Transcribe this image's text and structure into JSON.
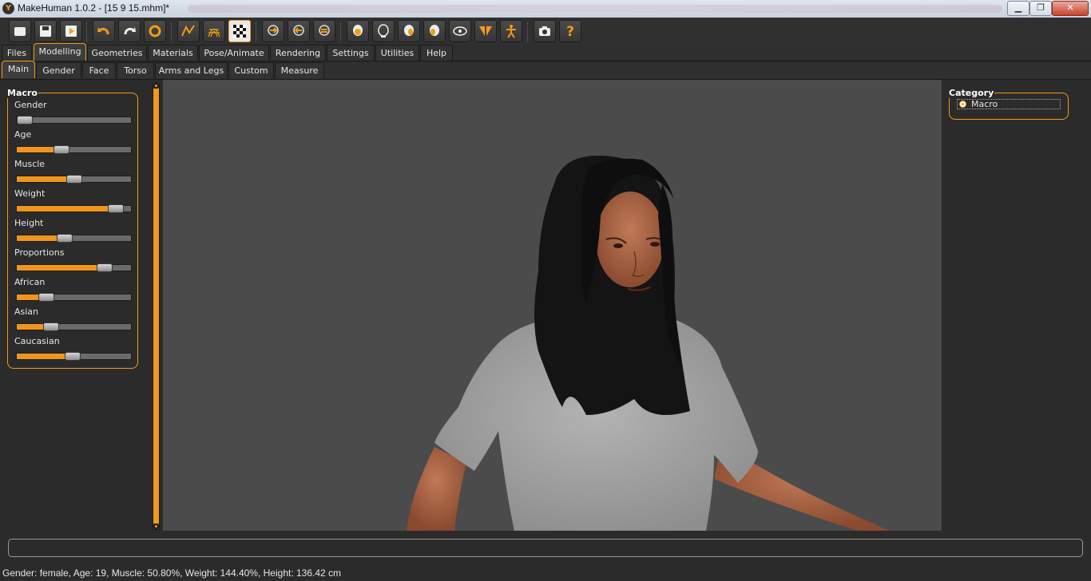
{
  "window": {
    "title": "MakeHuman 1.0.2 - [15 9 15.mhm]*",
    "buttons": {
      "minimize": "▁",
      "maximize": "❐",
      "close": "✕"
    }
  },
  "toolbar": {
    "icons": [
      "new-icon",
      "save-icon",
      "export-icon",
      "undo-icon",
      "redo-icon",
      "reset-icon",
      "smooth-icon",
      "wireframe-icon",
      "background-icon",
      "front-view-icon",
      "back-view-icon",
      "side-view-icon",
      "face-front-icon",
      "face-back-icon",
      "face-left-icon",
      "face-right-icon",
      "top-view-icon",
      "bottom-view-icon",
      "skeleton-icon",
      "screenshot-icon",
      "help-icon"
    ],
    "active": "background-icon",
    "accent": "#f39c12"
  },
  "main_tabs": [
    "Files",
    "Modelling",
    "Geometries",
    "Materials",
    "Pose/Animate",
    "Rendering",
    "Settings",
    "Utilities",
    "Help"
  ],
  "main_tab_active": "Modelling",
  "sub_tabs": [
    "Main",
    "Gender",
    "Face",
    "Torso",
    "Arms and Legs",
    "Custom",
    "Measure"
  ],
  "sub_tab_active": "Main",
  "macro": {
    "title": "Macro",
    "sliders": [
      {
        "label": "Gender",
        "value": 0.07
      },
      {
        "label": "Age",
        "value": 0.39
      },
      {
        "label": "Muscle",
        "value": 0.5
      },
      {
        "label": "Weight",
        "value": 0.87
      },
      {
        "label": "Height",
        "value": 0.42
      },
      {
        "label": "Proportions",
        "value": 0.77
      },
      {
        "label": "African",
        "value": 0.26
      },
      {
        "label": "Asian",
        "value": 0.3
      },
      {
        "label": "Caucasian",
        "value": 0.49
      }
    ]
  },
  "category": {
    "title": "Category",
    "items": [
      {
        "label": "Macro",
        "selected": true
      }
    ]
  },
  "status": "Gender: female, Age: 19, Muscle: 50.80%, Weight: 144.40%, Height: 136.42 cm"
}
